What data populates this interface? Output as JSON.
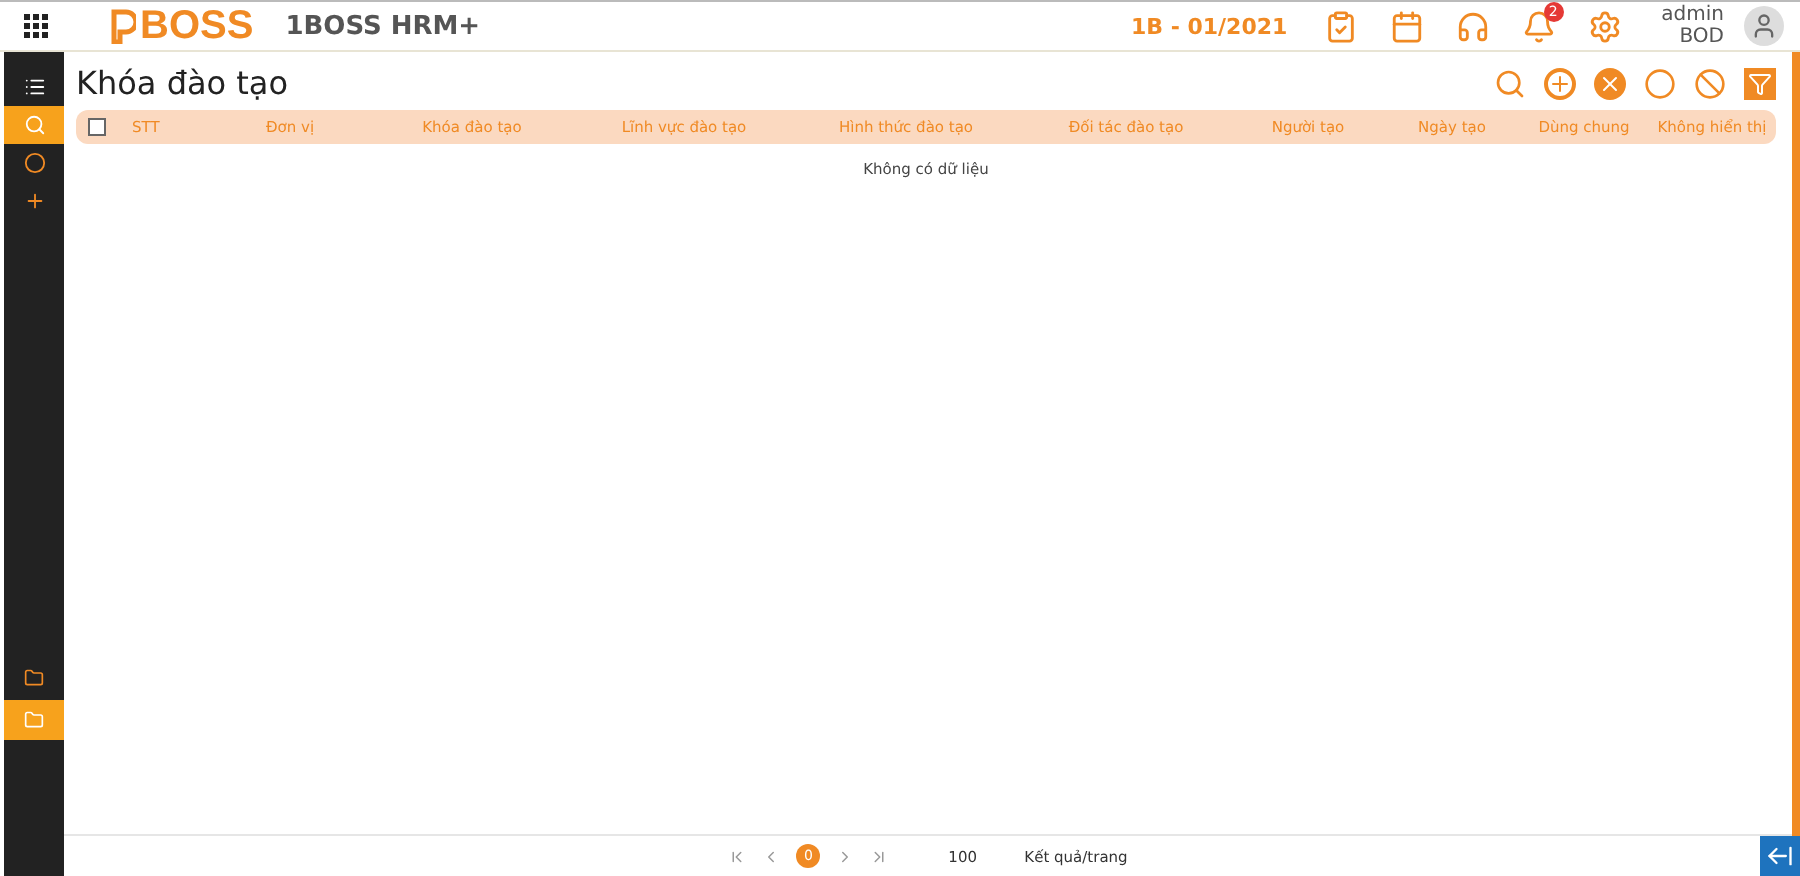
{
  "header": {
    "logo": "BOSS",
    "app_name": "1BOSS HRM+",
    "period": "1B - 01/2021",
    "notification_count": "2",
    "user_name": "admin",
    "user_role": "BOD"
  },
  "sidebar": {
    "top_items": [
      {
        "selected": false
      },
      {
        "selected": true
      },
      {
        "selected": false
      },
      {
        "selected": false
      }
    ],
    "bottom_items": [
      {
        "selected": false
      },
      {
        "selected": true
      }
    ]
  },
  "page": {
    "title": "Khóa đào tạo"
  },
  "table": {
    "select_all": {
      "checked": false
    },
    "columns": [
      "STT",
      "Đơn vị",
      "Khóa đào tạo",
      "Lĩnh vực đào tạo",
      "Hình thức đào tạo",
      "Đối tác đào tạo",
      "Người tạo",
      "Ngày tạo",
      "Dùng chung",
      "Không hiển thị"
    ],
    "empty_message": "Không có dữ liệu"
  },
  "pager": {
    "current_page": "0",
    "page_size": "100",
    "page_size_label": "Kết quả/trang"
  }
}
